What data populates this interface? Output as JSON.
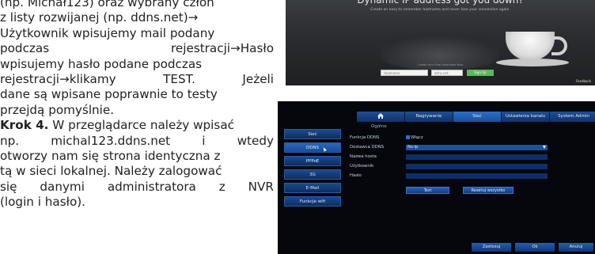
{
  "text": {
    "lines": [
      "(np. Michał123) oraz wybrany człon",
      "z listy rozwijanej (np. ddns.net)→",
      "Użytkownik wpisujemy mail podany",
      [
        "podczas",
        "rejestracji→Hasło"
      ],
      "wpisujemy hasło podane podczas",
      [
        "rejestracji→klikamy",
        "TEST.",
        "Jeżeli"
      ],
      "dane są wpisane poprawnie to testy",
      "przejdą pomyślnie.",
      "Krok 4.",
      " W przeglądarce należy wpisać",
      [
        "np.",
        "michal123.ddns.net",
        "i",
        "wtedy"
      ],
      "otworzy nam się strona identyczna z",
      "tą w sieci lokalnej. Należy zalogować",
      [
        "się",
        "danymi",
        "administratora",
        "z",
        "NVR"
      ],
      "(login i hasło)."
    ]
  },
  "top_screenshot": {
    "headline": "Dynamic IP address got you down?",
    "subtitle": "Create an easy to remember hostname and never lose your connection again.",
    "form_label": "Create Your Free Hostname Now",
    "hostname_placeholder": "Hostname",
    "domain_value": "ddns.net",
    "button": "Sign Up",
    "feedback": "Feedback"
  },
  "nvr": {
    "tabs": [
      "Nagrywanie",
      "Sieć",
      "Ustawienia kanału",
      "System Admin"
    ],
    "active_tab": "Sieć",
    "section_title": "Ogólne",
    "sidebar": [
      "Sieć",
      "DDNS",
      "PPPoE",
      "3G",
      "E-Mail",
      "Funkcje wifi"
    ],
    "active_sidebar": "DDNS",
    "labels": [
      "Funkcja DDNS",
      "Dostawca DDNS",
      "Nazwa hosta",
      "Użytkownik",
      "Hasło"
    ],
    "enable_label": "Włącz",
    "provider_value": "No-ip",
    "test_button": "Test",
    "reset_button": "Resetuj wszystko",
    "footer_buttons": [
      "Zastosuj",
      "Ok",
      "Anuluj"
    ]
  }
}
